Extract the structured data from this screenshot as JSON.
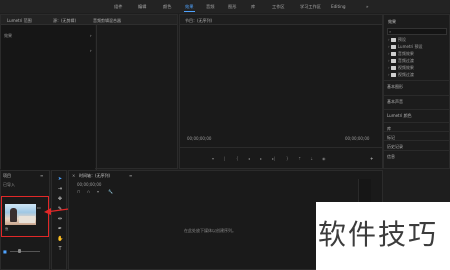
{
  "workspaces": [
    {
      "label": "组件"
    },
    {
      "label": "编辑"
    },
    {
      "label": "颜色"
    },
    {
      "label": "效果",
      "active": true
    },
    {
      "label": "音频"
    },
    {
      "label": "图形"
    },
    {
      "label": "库"
    },
    {
      "label": "工作区"
    },
    {
      "label": "学习工作区"
    },
    {
      "label": "Editing"
    }
  ],
  "overflow": "»",
  "source_panel": {
    "tab1": "Lumetri 范围",
    "tab2": "源：(无剪辑)",
    "tab3": "音频剪辑混合器",
    "row": "效果"
  },
  "program": {
    "title": "节目：(无序列)",
    "timecode_left": "00;00;00;00",
    "timecode_right": "00;00;00;00"
  },
  "effects_panel": {
    "title": "效果",
    "search_placeholder": "",
    "tree": [
      "预设",
      "Lumetri 预设",
      "音频效果",
      "音频过渡",
      "视频效果",
      "视频过渡"
    ],
    "sections": [
      "基本图形",
      "基本声音",
      "Lumetri 颜色",
      "库",
      "标记",
      "历史记录",
      "信息"
    ]
  },
  "project": {
    "title": "项目",
    "subtitle": "已导入",
    "clip_caption": "鱼"
  },
  "timeline": {
    "title": "时间轴：(无序列)",
    "timecode": "00;00;00;00",
    "empty_text": "在此处放下媒体以创建序列。"
  },
  "watermark": {
    "text": "软件技巧"
  },
  "colors": {
    "accent": "#4fa3ff",
    "highlight_border": "#e12828"
  }
}
